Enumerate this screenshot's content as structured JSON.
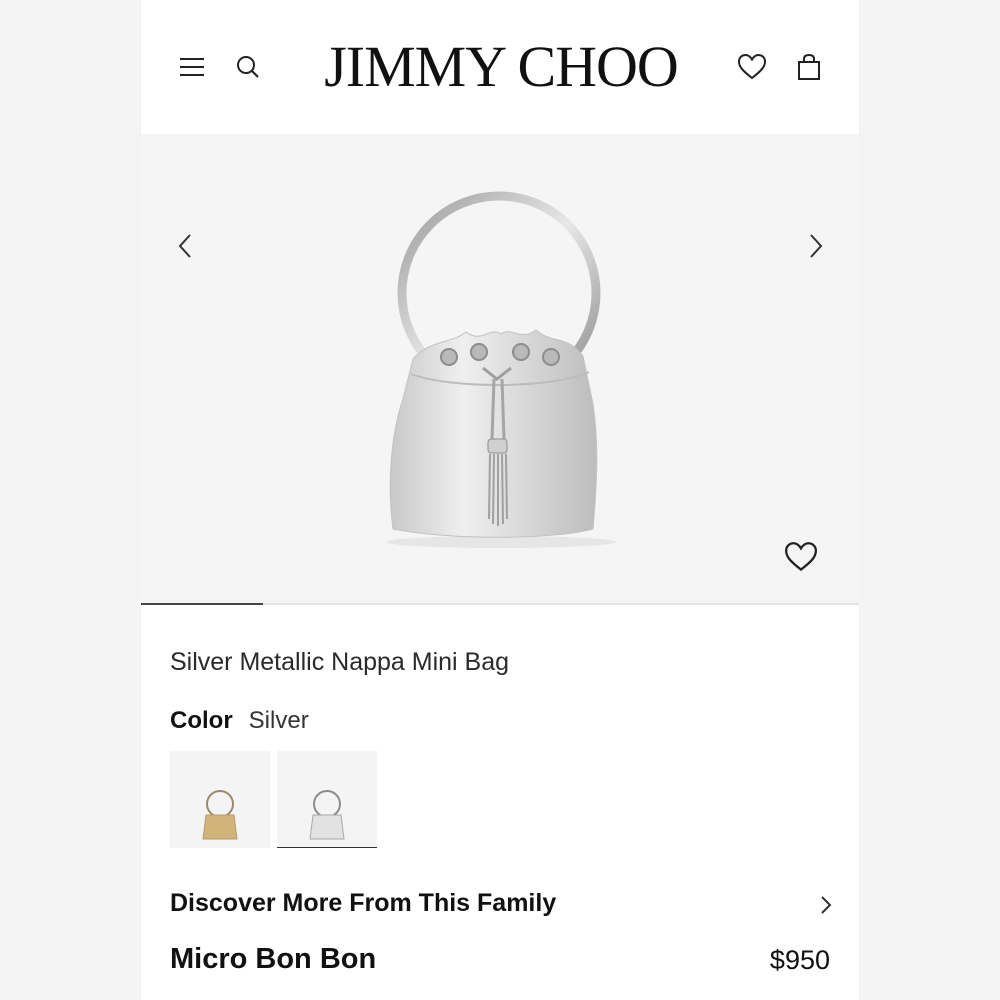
{
  "header": {
    "brand": "JIMMY CHOO",
    "menu_icon": "hamburger-menu-icon",
    "search_icon": "search-icon",
    "wishlist_icon": "heart-icon",
    "bag_icon": "shopping-bag-icon"
  },
  "gallery": {
    "prev_icon": "chevron-left-icon",
    "next_icon": "chevron-right-icon",
    "favorite_icon": "heart-icon",
    "progress_fraction": 0.17
  },
  "product": {
    "title": "Silver Metallic Nappa Mini Bag",
    "color_label": "Color",
    "color_value": "Silver",
    "swatches": [
      {
        "name": "Gold",
        "selected": false,
        "tone": "#d2b47a"
      },
      {
        "name": "Silver",
        "selected": true,
        "tone": "#d9d9d9"
      }
    ]
  },
  "family": {
    "discover_label": "Discover More From This Family",
    "item_name": "Micro Bon Bon",
    "item_price": "$950"
  },
  "colors": {
    "background": "#f3f3f3",
    "panel": "#ffffff",
    "hero_bg": "#f5f5f5",
    "text": "#1a1a1a"
  }
}
